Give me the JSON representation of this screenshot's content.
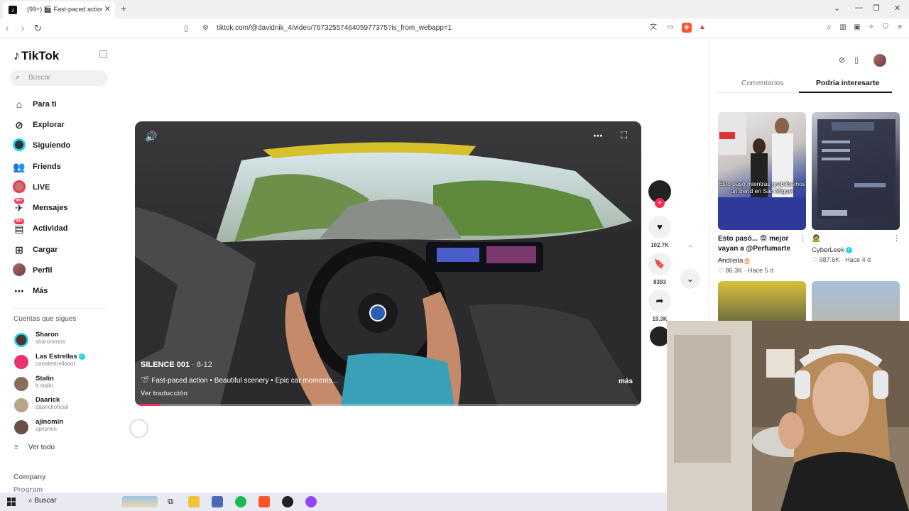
{
  "browser": {
    "tab_title": "(99+) 🎬 Fast-paced action • ",
    "new_tab": "+",
    "url": "tiktok.com/@davidnik_4/video/7673255746405977375?is_from_webapp=1"
  },
  "sidebar": {
    "logo": "TikTok",
    "search_placeholder": "Buscar",
    "items": [
      {
        "label": "Para ti",
        "icon": "home-icon"
      },
      {
        "label": "Explorar",
        "icon": "compass-icon"
      },
      {
        "label": "Siguiendo",
        "icon": "following-icon"
      },
      {
        "label": "Friends",
        "icon": "friends-icon"
      },
      {
        "label": "LIVE",
        "icon": "live-icon"
      },
      {
        "label": "Mensajes",
        "icon": "messages-icon",
        "badge": "99+"
      },
      {
        "label": "Actividad",
        "icon": "activity-icon",
        "badge": "99+"
      },
      {
        "label": "Cargar",
        "icon": "upload-icon"
      },
      {
        "label": "Perfil",
        "icon": "profile-icon"
      },
      {
        "label": "Más",
        "icon": "more-icon"
      }
    ],
    "following_title": "Cuentas que sigues",
    "following": [
      {
        "name": "Sharon",
        "handle": "sharonnnns"
      },
      {
        "name": "Las Estrellas",
        "handle": "canalestrellasof",
        "verified": true
      },
      {
        "name": "Stalin",
        "handle": "it.stalin"
      },
      {
        "name": "Daarick",
        "handle": "daarickoficial"
      },
      {
        "name": "ajinomin",
        "handle": "ajinomin"
      }
    ],
    "see_all": "Ver todo",
    "company": "Company",
    "program": "Program"
  },
  "video": {
    "author": "SILENCE 001",
    "date": " · 8-12",
    "caption": "🎬 Fast-paced action • Beautiful scenery • Epic car moments...",
    "translate": "Ver traducción",
    "more": "más",
    "progress": 0.05
  },
  "actions": {
    "likes": "102.7K",
    "saves": "8383",
    "shares": "19.3K"
  },
  "right_panel": {
    "tabs": [
      "Comentarios",
      "Podría interesarte"
    ],
    "active_tab": 1,
    "recommendations": [
      {
        "title": "Esto pasó... 😨 mejor vayan a @Perfumarte ...",
        "author": "Andreita🎂",
        "likes": "86.3K",
        "time": "Hace 5 d",
        "overlay": "Esto pasó mientras grabábamos un trend en San Miguel"
      },
      {
        "title": "🧟",
        "author": "CyberLeek",
        "verified": true,
        "likes": "987.6K",
        "time": "Hace 4 d",
        "overlay": ""
      }
    ]
  },
  "taskbar": {
    "search": "Buscar"
  },
  "colors": {
    "accent": "#fe2c55",
    "verified": "#20d5ec"
  }
}
